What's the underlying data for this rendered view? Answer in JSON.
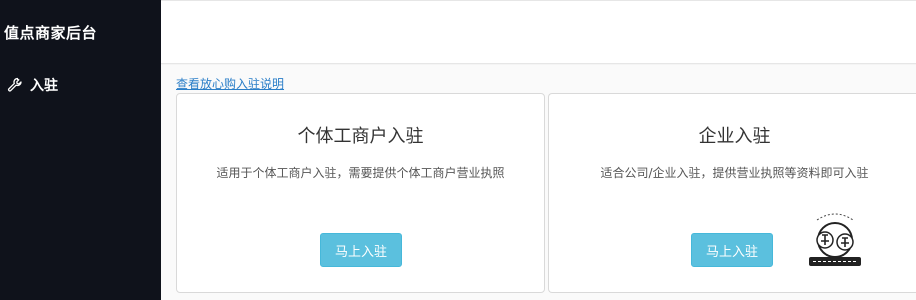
{
  "app": {
    "title": "值点商家后台"
  },
  "sidebar": {
    "items": [
      {
        "label": "入驻",
        "icon": "wrench-icon"
      }
    ]
  },
  "main": {
    "help_link": "查看放心购入驻说明",
    "cards": [
      {
        "title": "个体工商户入驻",
        "description": "适用于个体工商户入驻，需要提供个体工商户营业执照",
        "button": "马上入驻"
      },
      {
        "title": "企业入驻",
        "description": "适合公司/企业入驻，提供营业执照等资料即可入驻",
        "button": "马上入驻"
      }
    ]
  },
  "colors": {
    "sidebar_bg": "#0f121b",
    "accent": "#5bc0de",
    "link": "#2a7ec8"
  }
}
